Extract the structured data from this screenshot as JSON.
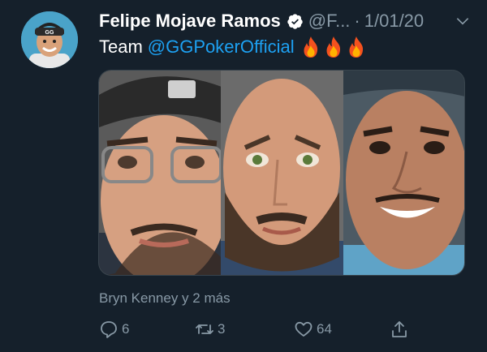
{
  "tweet": {
    "author_name": "Felipe Mojave Ramos",
    "handle": "@F...",
    "separator": "·",
    "date": "1/01/20",
    "text_prefix": "Team",
    "mention": "@GGPokerOfficial",
    "emoji": [
      "fire-icon",
      "fire-icon",
      "fire-icon"
    ],
    "liked_by": "Bryn Kenney y 2 más"
  },
  "actions": {
    "replies": "6",
    "retweets": "3",
    "likes": "64"
  },
  "colors": {
    "background": "#15202b",
    "secondary_text": "#8899a6",
    "link": "#1da1f2",
    "verified": "#ffffff"
  }
}
